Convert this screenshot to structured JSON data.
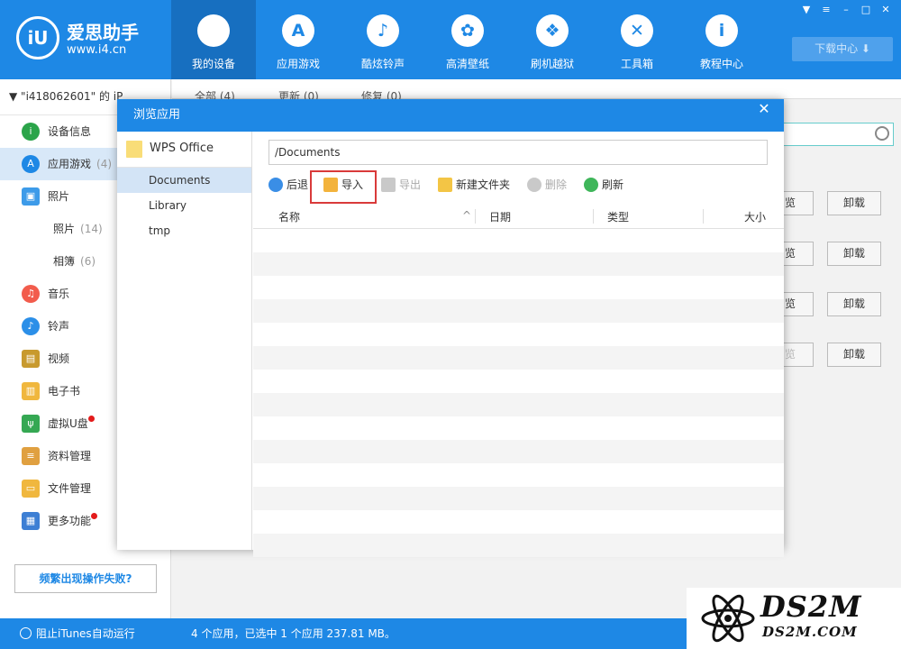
{
  "app": {
    "logo_text": "iU",
    "name": "爱思助手",
    "url": "www.i4.cn"
  },
  "nav": [
    {
      "label": "我的设备",
      "icon": "apple-icon",
      "glyph": "",
      "active": true
    },
    {
      "label": "应用游戏",
      "icon": "appstore-icon",
      "glyph": "A"
    },
    {
      "label": "酷炫铃声",
      "icon": "bell-icon",
      "glyph": "♪"
    },
    {
      "label": "高清壁纸",
      "icon": "flower-icon",
      "glyph": "✿"
    },
    {
      "label": "刷机越狱",
      "icon": "box-icon",
      "glyph": "❖"
    },
    {
      "label": "工具箱",
      "icon": "tools-icon",
      "glyph": "✕"
    },
    {
      "label": "教程中心",
      "icon": "info-icon",
      "glyph": "i"
    }
  ],
  "window_controls": [
    "shirt-icon",
    "menu-icon",
    "minimize-icon",
    "maximize-icon",
    "close-icon"
  ],
  "download_center": "下载中心 ⬇",
  "device_name": "▼  \"i418062601\" 的 iP",
  "sidebar": [
    {
      "label": "设备信息",
      "icon": "info-icon",
      "glyph": "i",
      "color": "#2ba44a"
    },
    {
      "label": "应用游戏",
      "count": "(4)",
      "icon": "appstore-icon",
      "glyph": "A",
      "color": "#1e88e5",
      "active": true
    },
    {
      "label": "照片",
      "icon": "photo-icon",
      "glyph": "▣",
      "color": "#3d9be9",
      "square": true
    },
    {
      "label": "照片",
      "count": "(14)",
      "sub": true
    },
    {
      "label": "相簿",
      "count": "(6)",
      "sub": true
    },
    {
      "label": "音乐",
      "icon": "music-icon",
      "glyph": "♫",
      "color": "#f25c4c"
    },
    {
      "label": "铃声",
      "icon": "bell-icon",
      "glyph": "♪",
      "color": "#2b8fe8"
    },
    {
      "label": "视频",
      "icon": "video-icon",
      "glyph": "▤",
      "color": "#c89a2e",
      "square": true
    },
    {
      "label": "电子书",
      "icon": "book-icon",
      "glyph": "▥",
      "color": "#f0b73e",
      "square": true
    },
    {
      "label": "虚拟U盘",
      "icon": "usb-icon",
      "glyph": "ψ",
      "color": "#35a853",
      "square": true,
      "dot": true
    },
    {
      "label": "资料管理",
      "icon": "document-icon",
      "glyph": "≡",
      "color": "#e0a040",
      "square": true
    },
    {
      "label": "文件管理",
      "icon": "file-icon",
      "glyph": "▭",
      "color": "#f0b73e",
      "square": true
    },
    {
      "label": "更多功能",
      "icon": "grid-icon",
      "glyph": "▦",
      "color": "#3d7fd4",
      "square": true,
      "dot": true
    }
  ],
  "fail_button": "频繁出现操作失败?",
  "main_tabs": [
    "全部 (4)",
    "更新 (0)",
    "修复 (0)"
  ],
  "list_actions": [
    {
      "preview": "览",
      "uninstall": "卸载"
    },
    {
      "preview": "览",
      "uninstall": "卸载"
    },
    {
      "preview": "览",
      "uninstall": "卸载"
    },
    {
      "preview": "览",
      "uninstall": "卸载",
      "preview_disabled": true
    }
  ],
  "statusbar": {
    "itunes": "阻止iTunes自动运行",
    "selection": "4 个应用，已选中 1 个应用 237.81 MB。"
  },
  "watermark": {
    "big": "DS2M",
    "small": "DS2M.COM"
  },
  "dialog": {
    "title": "浏览应用",
    "close": "✕",
    "app_name": "WPS Office",
    "folders": [
      "Documents",
      "Library",
      "tmp"
    ],
    "active_folder": 0,
    "path": "/Documents",
    "toolbar": [
      {
        "label": "后退",
        "icon": "back-icon",
        "color": "#3a8ee6",
        "round": true
      },
      {
        "label": "导入",
        "icon": "import-icon",
        "color": "#f3b33c"
      },
      {
        "label": "导出",
        "icon": "export-icon",
        "color": "#c9c9c9",
        "disabled": true
      },
      {
        "label": "新建文件夹",
        "icon": "new-folder-icon",
        "color": "#f3c545"
      },
      {
        "label": "删除",
        "icon": "delete-icon",
        "color": "#c9c9c9",
        "disabled": true,
        "round": true
      },
      {
        "label": "刷新",
        "icon": "refresh-icon",
        "color": "#3fb65a",
        "round": true
      }
    ],
    "columns": [
      "名称",
      "日期",
      "类型",
      "大小"
    ],
    "sort_indicator": "^"
  }
}
